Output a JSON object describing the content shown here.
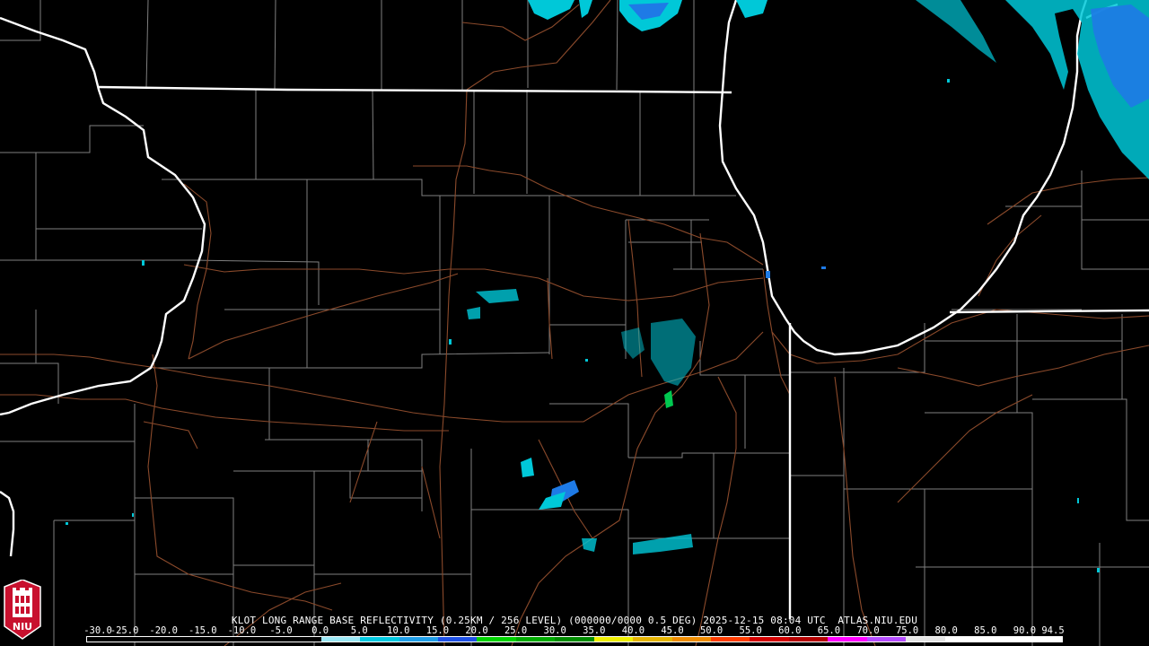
{
  "header": {
    "title": "KLOT LONG RANGE BASE REFLECTIVITY (0.25KM / 256 LEVEL) (000000/0000 0.5 DEG) 2025-12-15 08:04 UTC  ATLAS.NIU.EDU"
  },
  "logo": {
    "text": "NIU",
    "icon": "niu-tower-logo-icon",
    "color": "#c8102e"
  },
  "colors": {
    "background": "#000000",
    "state_borders": "#ffffff",
    "county_lines": "#7f7f7f",
    "highways": "#8b4a2b",
    "echo_light": "#00c8d8",
    "echo_mid": "#1e7ae6",
    "echo_green": "#00c850"
  },
  "scale": {
    "labels": [
      "-30.0",
      "-25.0",
      "-20.0",
      "-15.0",
      "-10.0",
      "-5.0",
      "0.0",
      "5.0",
      "10.0",
      "15.0",
      "20.0",
      "25.0",
      "30.0",
      "35.0",
      "40.0",
      "45.0",
      "50.0",
      "55.0",
      "60.0",
      "65.0",
      "70.0",
      "75.0",
      "80.0",
      "85.0",
      "90.0",
      "94.5"
    ],
    "colors": [
      "#000000",
      "#000000",
      "#000000",
      "#000000",
      "#000000",
      "#000000",
      "#9be7f5",
      "#00c8e0",
      "#1f9ee8",
      "#1e50e6",
      "#00d200",
      "#00aa00",
      "#008c00",
      "#f0f000",
      "#e6b400",
      "#f08c00",
      "#ff3c00",
      "#d20000",
      "#b40000",
      "#ff00ff",
      "#b44cff",
      "#e6e6e6",
      "#ffffff",
      "#ffffff",
      "#ffffff"
    ]
  }
}
